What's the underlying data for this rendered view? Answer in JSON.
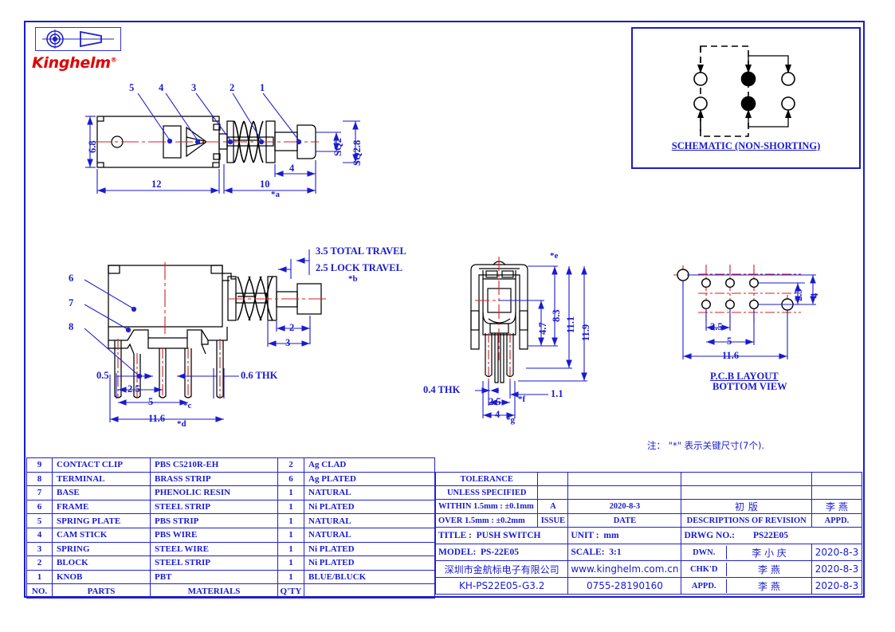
{
  "logo": {
    "brand": "Kinghelm",
    "trademark": "®",
    "symbol_projection": "first-angle-projection-symbol"
  },
  "schematic": {
    "label": "SCHEMATIC  (NON-SHORTING)",
    "pins": 6,
    "filled_pins": 2,
    "open_pins": 4
  },
  "views": {
    "top": {
      "callouts": [
        "5",
        "4",
        "3",
        "2",
        "1"
      ],
      "dimensions": {
        "height": "6.8",
        "body_length": "12",
        "plunger_length": "10",
        "tip_length": "4",
        "sq_inner": "SQ2",
        "sq_outer": "SQ2.8",
        "key_a": "*a"
      }
    },
    "side": {
      "callouts": [
        "6",
        "7",
        "8"
      ],
      "dimensions": {
        "total_travel": "3.5  TOTAL TRAVEL",
        "lock_travel": "2.5  LOCK TRAVEL",
        "key_b": "*b",
        "dim_2": "2",
        "dim_3": "3",
        "pin_offset": "0.5",
        "pin_pitch": "2.5",
        "pin_span": "5",
        "key_c": "*c",
        "body_width": "11.6",
        "key_d": "*d",
        "thickness": "0.6  THK"
      }
    },
    "front": {
      "dimensions": {
        "key_e": "*e",
        "h_4_7": "4.7",
        "h_8_3": "8.3",
        "h_11_1": "11.1",
        "h_11_9": "11.9",
        "w_1_1": "1.1",
        "thickness": "0.4  THK",
        "pitch_2_5": "2.5",
        "key_f": "*f",
        "w_4": "4",
        "key_g": "*g"
      }
    },
    "pcb": {
      "title_line1": "P.C.B  LAYOUT",
      "title_line2": "BOTTOM VIEW",
      "dimensions": {
        "pitch_2_5": "2.5",
        "span_5": "5",
        "width_11_6": "11.6",
        "v_2_5": "2.5",
        "v_4": "4"
      }
    }
  },
  "note": "注：  \"*\"   表示关键尺寸(7个).",
  "parts_table": {
    "headers": {
      "no": "NO.",
      "parts": "PARTS",
      "materials": "MATERIALS",
      "qty": "Q'TY",
      "finish": ""
    },
    "rows": [
      {
        "no": "9",
        "part": "CONTACT CLIP",
        "material": "PBS C5210R-EH",
        "qty": "2",
        "finish": "Ag CLAD"
      },
      {
        "no": "8",
        "part": "TERMINAL",
        "material": "BRASS STRIP",
        "qty": "6",
        "finish": "Ag PLATED"
      },
      {
        "no": "7",
        "part": "BASE",
        "material": "PHENOLIC RESIN",
        "qty": "1",
        "finish": "NATURAL"
      },
      {
        "no": "6",
        "part": "FRAME",
        "material": "STEEL STRIP",
        "qty": "1",
        "finish": "Ni PLATED"
      },
      {
        "no": "5",
        "part": "SPRING PLATE",
        "material": "PBS STRIP",
        "qty": "1",
        "finish": "NATURAL"
      },
      {
        "no": "4",
        "part": "CAM STICK",
        "material": "PBS WIRE",
        "qty": "1",
        "finish": "NATURAL"
      },
      {
        "no": "3",
        "part": "SPRING",
        "material": "STEEL WIRE",
        "qty": "1",
        "finish": "Ni PLATED"
      },
      {
        "no": "2",
        "part": "BLOCK",
        "material": "STEEL STRIP",
        "qty": "1",
        "finish": "Ni PLATED"
      },
      {
        "no": "1",
        "part": "KNOB",
        "material": "PBT",
        "qty": "1",
        "finish": "BLUE/BLUCK"
      }
    ]
  },
  "title_block": {
    "tolerance_line1": "TOLERANCE",
    "tolerance_line2": "UNLESS   SPECIFIED",
    "tol_within": "WITHIN 1.5mm : ±0.1mm",
    "tol_over": "OVER 1.5mm : ±0.2mm",
    "issue_value": "A",
    "issue_label": "ISSUE",
    "date_value": "2020-8-3",
    "date_label": "DATE",
    "revision_value": "初    版",
    "revision_label": "DESCRIPTIONS OF REVISION",
    "appd_rev_value": "李 燕",
    "appd_rev_label": "APPD.",
    "title_label": "TITLE :",
    "title_value": "PUSH SWITCH",
    "model_label": "MODEL:",
    "model_value": "PS-22E05",
    "unit_label": "UNIT :",
    "unit_value": "mm",
    "scale_label": "SCALE:",
    "scale_value": "3:1",
    "drwg_no_label": "DRWG NO.:",
    "drwg_no_value": "PS22E05",
    "dwn_label": "DWN.",
    "dwn_name": "李 小 庆",
    "dwn_date": "2020-8-3",
    "chkd_label": "CHK'D",
    "chkd_name": "李  燕",
    "chkd_date": "2020-8-3",
    "appd_label": "APPD.",
    "appd_name": "李  燕",
    "appd_date": "2020-8-3",
    "company": "深圳市金航标电子有限公司",
    "website": "www.kinghelm.com.cn",
    "part_number": "KH-PS22E05-G3.2",
    "phone": "0755-28190160"
  },
  "colors": {
    "border_blue": "#1a1ad0",
    "dim_blue": "#1a1ad0",
    "centerline_red": "#d02020",
    "outline_black": "#000000",
    "logo_red": "#e00000"
  }
}
